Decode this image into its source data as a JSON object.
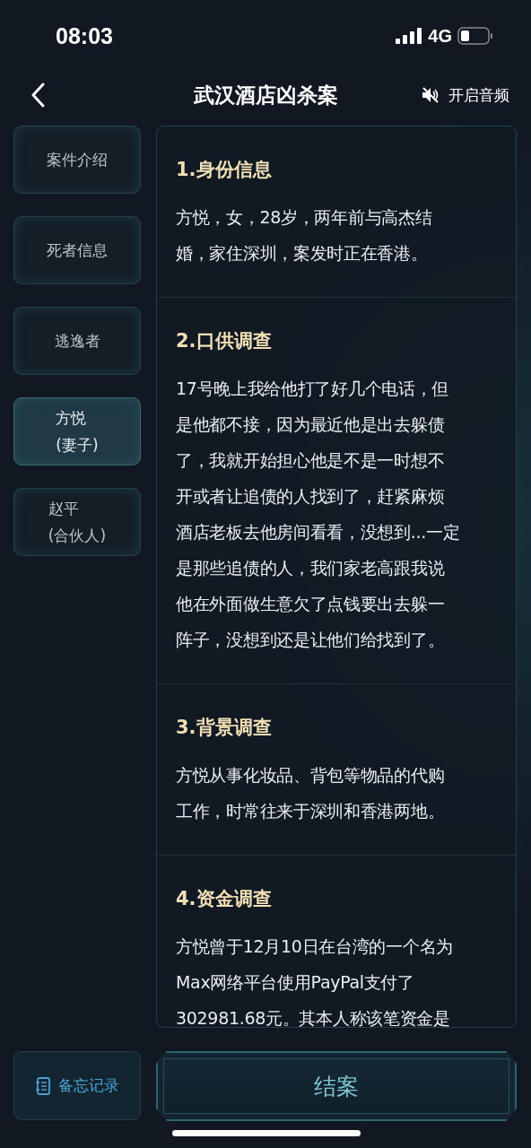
{
  "status_bar": {
    "time": "08:03",
    "network": "4G"
  },
  "header": {
    "title": "武汉酒店凶杀案",
    "audio_button": "开启音频"
  },
  "sidebar": {
    "items": [
      {
        "label": "案件介绍",
        "selected": false
      },
      {
        "label": "死者信息",
        "selected": false
      },
      {
        "label": "逃逸者",
        "selected": false
      },
      {
        "label": "方悦\n(妻子)",
        "selected": true
      },
      {
        "label": "赵平\n(合伙人)",
        "selected": false
      }
    ]
  },
  "sections": [
    {
      "heading": "1.身份信息",
      "body": "方悦，女，28岁，两年前与高杰结婚，家住深圳，案发时正在香港。"
    },
    {
      "heading": "2.口供调查",
      "body": "17号晚上我给他打了好几个电话，但是他都不接，因为最近他是出去躲债了，我就开始担心他是不是一时想不开或者让追债的人找到了，赶紧麻烦酒店老板去他房间看看，没想到...一定是那些追债的人，我们家老高跟我说他在外面做生意欠了点钱要出去躲一阵子，没想到还是让他们给找到了。"
    },
    {
      "heading": "3.背景调查",
      "body": "方悦从事化妆品、背包等物品的代购工作，时常往来于深圳和香港两地。"
    },
    {
      "heading": "4.资金调查",
      "body": "方悦曾于12月10日在台湾的一个名为Max网络平台使用PayPal支付了302981.68元。其本人称该笔资金是"
    }
  ],
  "bottom": {
    "memo_button": "备忘记录",
    "close_case_button": "结案"
  }
}
